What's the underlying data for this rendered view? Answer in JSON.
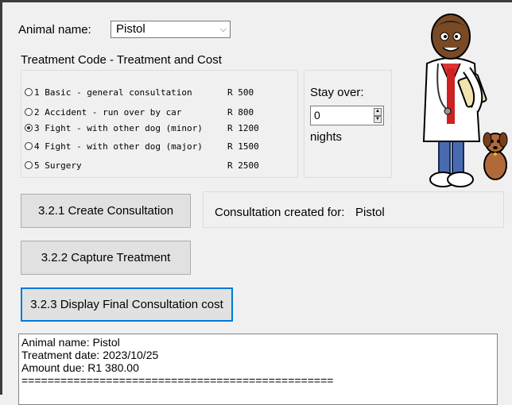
{
  "form": {
    "animal_label": "Animal name:",
    "animal_value": "Pistol",
    "treatment_heading": "Treatment Code - Treatment and Cost"
  },
  "treatments": [
    {
      "text": "1 Basic - general consultation",
      "cost": "R 500",
      "selected": false
    },
    {
      "text": "2 Accident - run over by car",
      "cost": "R 800",
      "selected": false
    },
    {
      "text": "3 Fight - with other dog (minor)",
      "cost": "R 1200",
      "selected": true
    },
    {
      "text": "4 Fight - with other dog (major)",
      "cost": "R 1500",
      "selected": false
    },
    {
      "text": "5 Surgery",
      "cost": "R 2500",
      "selected": false
    }
  ],
  "stay": {
    "label": "Stay over:",
    "value": "0",
    "unit": "nights"
  },
  "buttons": {
    "create": "3.2.1 Create Consultation",
    "capture": "3.2.2 Capture Treatment",
    "display": "3.2.3 Display Final Consultation cost"
  },
  "status": {
    "label": "Consultation created for:",
    "value": "Pistol"
  },
  "output": {
    "line1": "Animal name: Pistol",
    "line2": "Treatment date: 2023/10/25",
    "line3": "Amount due: R1 380.00",
    "line4": "================================================"
  },
  "colors": {
    "accent": "#0078d7",
    "window_bg": "#f0f0f0"
  }
}
